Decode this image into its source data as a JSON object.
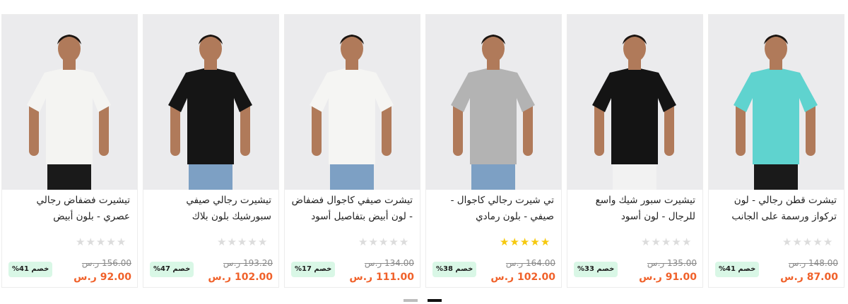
{
  "products": [
    {
      "title": "تيشيرت فضفاض رجالي عصري - بلون أبيض",
      "old_price": "156.00 ر.س",
      "new_price": "92.00 ر.س",
      "discount": "خصم 41%",
      "rating": 0,
      "shirt_color": "#f4f4f2"
    },
    {
      "title": "تيشيرت رجالي صيفي سبورشيك بلون بلاك",
      "old_price": "193.20 ر.س",
      "new_price": "102.00 ر.س",
      "discount": "خصم 47%",
      "rating": 0,
      "shirt_color": "#151515"
    },
    {
      "title": "تيشرت صيفي كاجوال فضفاض - لون أبيض بتفاصيل أسود",
      "old_price": "134.00 ر.س",
      "new_price": "111.00 ر.س",
      "discount": "خصم 17%",
      "rating": 0,
      "shirt_color": "#f5f5f3"
    },
    {
      "title": "تي شيرت رجالي كاجوال - صيفي - بلون رمادي",
      "old_price": "164.00 ر.س",
      "new_price": "102.00 ر.س",
      "discount": "خصم 38%",
      "rating": 5,
      "shirt_color": "#b3b3b3"
    },
    {
      "title": "تيشيرت سبور شيك واسع للرجال - لون أسود",
      "old_price": "135.00 ر.س",
      "new_price": "91.00 ر.س",
      "discount": "خصم 33%",
      "rating": 0,
      "shirt_color": "#141414"
    },
    {
      "title": "تيشرت قطن رجالي - لون تركواز ورسمة على الجانب",
      "old_price": "148.00 ر.س",
      "new_price": "87.00 ر.س",
      "discount": "خصم 41%",
      "rating": 0,
      "shirt_color": "#5fd3cf"
    }
  ],
  "pagination": {
    "pages": 2,
    "current": 2
  },
  "colors": {
    "price": "#f0612a",
    "badge_bg": "#d9f7e6",
    "star_on": "#f6c90e",
    "star_off": "#dcdcdc"
  }
}
